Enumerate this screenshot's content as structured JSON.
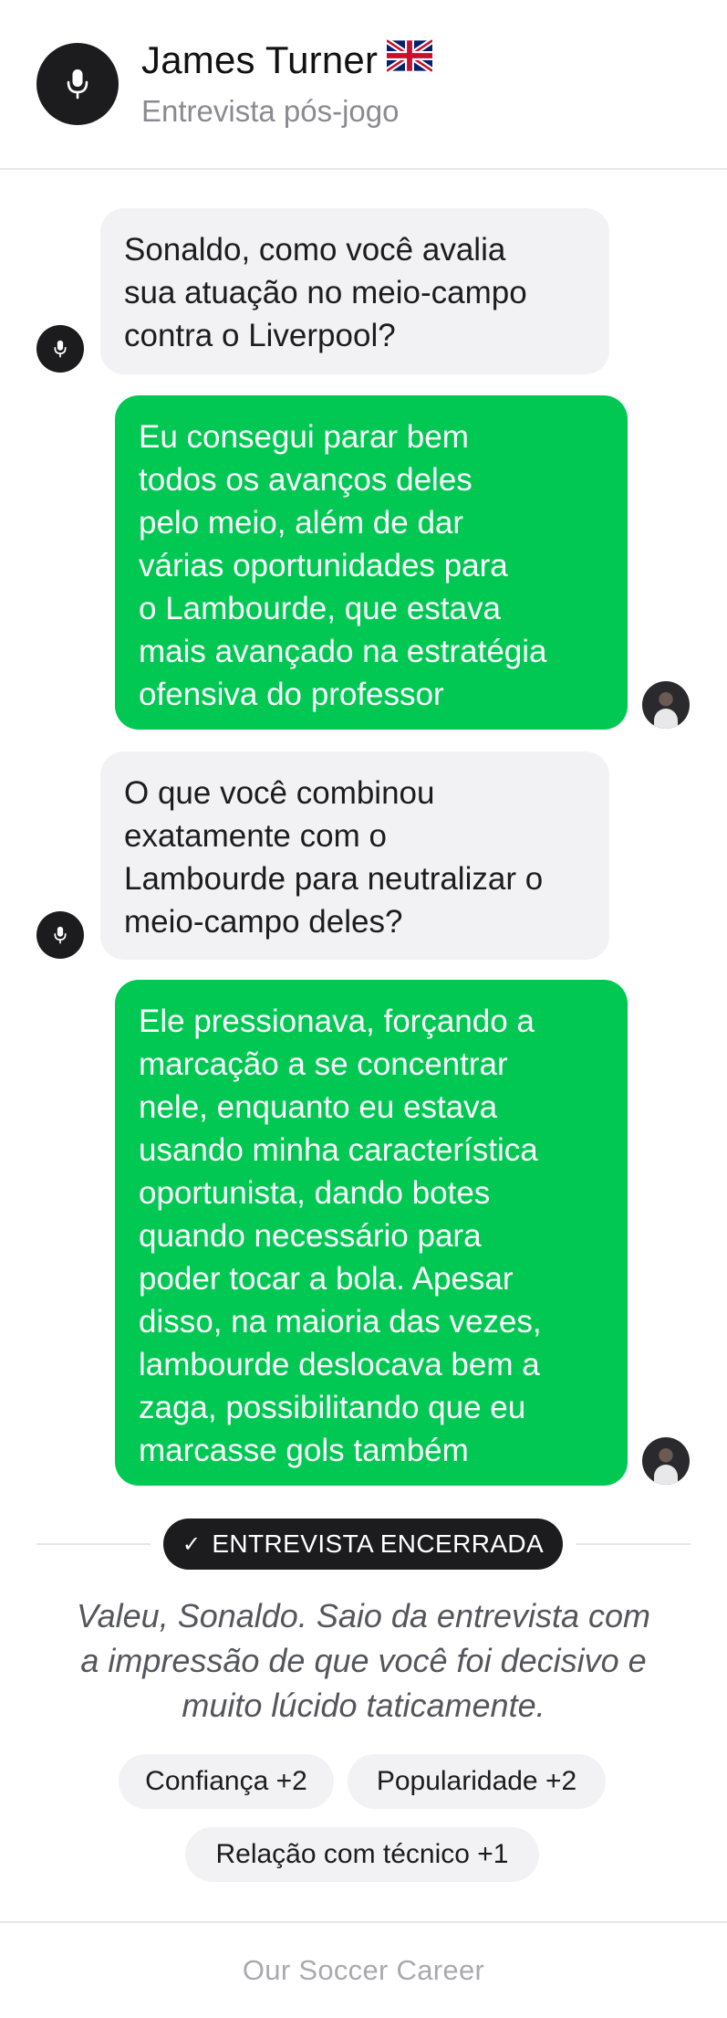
{
  "header": {
    "name": "James Turner",
    "flag_icon": "uk-flag-icon",
    "subtitle": "Entrevista pós-jogo",
    "avatar_icon": "microphone-icon"
  },
  "messages": [
    {
      "role": "interviewer",
      "lines": [
        "Sonaldo, como você avalia",
        "sua atuação no meio-campo",
        "contra o Liverpool?"
      ]
    },
    {
      "role": "player",
      "lines": [
        "Eu consegui parar bem",
        "todos os avanços deles",
        "pelo meio, além de dar",
        "várias oportunidades para",
        "o Lambourde, que estava",
        "mais avançado na estratégia",
        "ofensiva do professor"
      ]
    },
    {
      "role": "interviewer",
      "lines": [
        "O que você combinou",
        "exatamente com o",
        "Lambourde para neutralizar o",
        "meio-campo deles?"
      ]
    },
    {
      "role": "player",
      "lines": [
        "Ele pressionava, forçando a",
        "marcação a se concentrar",
        "nele, enquanto eu estava",
        "usando minha característica",
        "oportunista, dando botes",
        "quando necessário para",
        "poder tocar a bola. Apesar",
        "disso, na maioria das vezes,",
        "lambourde deslocava bem a",
        "zaga, possibilitando que eu",
        "marcasse gols também"
      ]
    }
  ],
  "status": {
    "ended_label": "ENTREVISTA ENCERRADA",
    "check_icon": "check-icon"
  },
  "closing": {
    "lines": [
      "Valeu, Sonaldo. Saio da entrevista com",
      "a impressão de que você foi decisivo e",
      "muito lúcido taticamente."
    ]
  },
  "effects": [
    {
      "label": "Confiança +2"
    },
    {
      "label": "Popularidade +2"
    },
    {
      "label": "Relação com técnico +1"
    }
  ],
  "footer": {
    "brand": "Our Soccer Career"
  },
  "colors": {
    "accent_green": "#00c853",
    "bubble_gray": "#f2f2f4",
    "dark": "#1c1c1e"
  }
}
